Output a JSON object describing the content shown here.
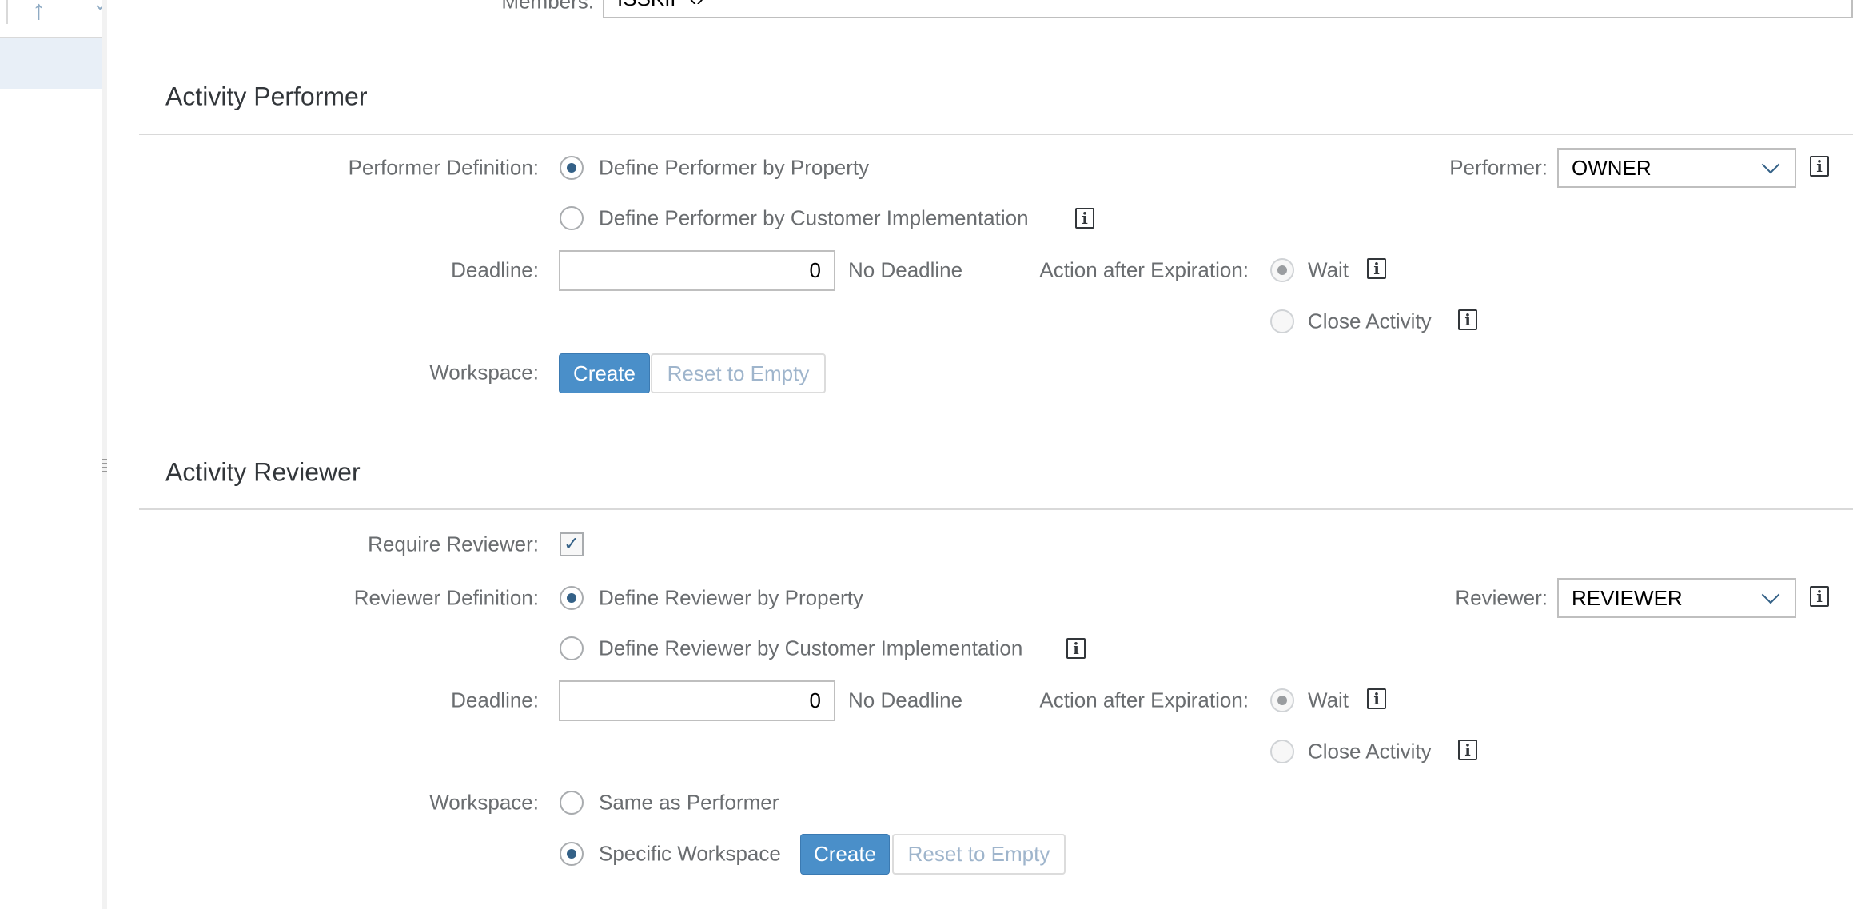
{
  "top": {
    "members_label": "Members:",
    "members_value": "ISSKIP"
  },
  "performer": {
    "title": "Activity Performer",
    "definition_label": "Performer Definition:",
    "option_property": "Define Performer by Property",
    "option_custom": "Define Performer by Customer Implementation",
    "selected": "property",
    "performer_label": "Performer:",
    "performer_value": "OWNER",
    "deadline_label": "Deadline:",
    "deadline_value": "0",
    "no_deadline": "No Deadline",
    "action_label": "Action after Expiration:",
    "action_wait": "Wait",
    "action_close": "Close Activity",
    "workspace_label": "Workspace:",
    "create": "Create",
    "reset": "Reset to Empty"
  },
  "reviewer": {
    "title": "Activity Reviewer",
    "require_label": "Require Reviewer:",
    "require_checked": true,
    "definition_label": "Reviewer Definition:",
    "option_property": "Define Reviewer by Property",
    "option_custom": "Define Reviewer by Customer Implementation",
    "reviewer_label": "Reviewer:",
    "reviewer_value": "REVIEWER",
    "deadline_label": "Deadline:",
    "deadline_value": "0",
    "no_deadline": "No Deadline",
    "action_label": "Action after Expiration:",
    "action_wait": "Wait",
    "action_close": "Close Activity",
    "workspace_label": "Workspace:",
    "ws_same": "Same as Performer",
    "ws_specific": "Specific Workspace",
    "create": "Create",
    "reset": "Reset to Empty"
  },
  "colors": {
    "accent": "#4a8fc9",
    "radio_selected": "#346187"
  }
}
